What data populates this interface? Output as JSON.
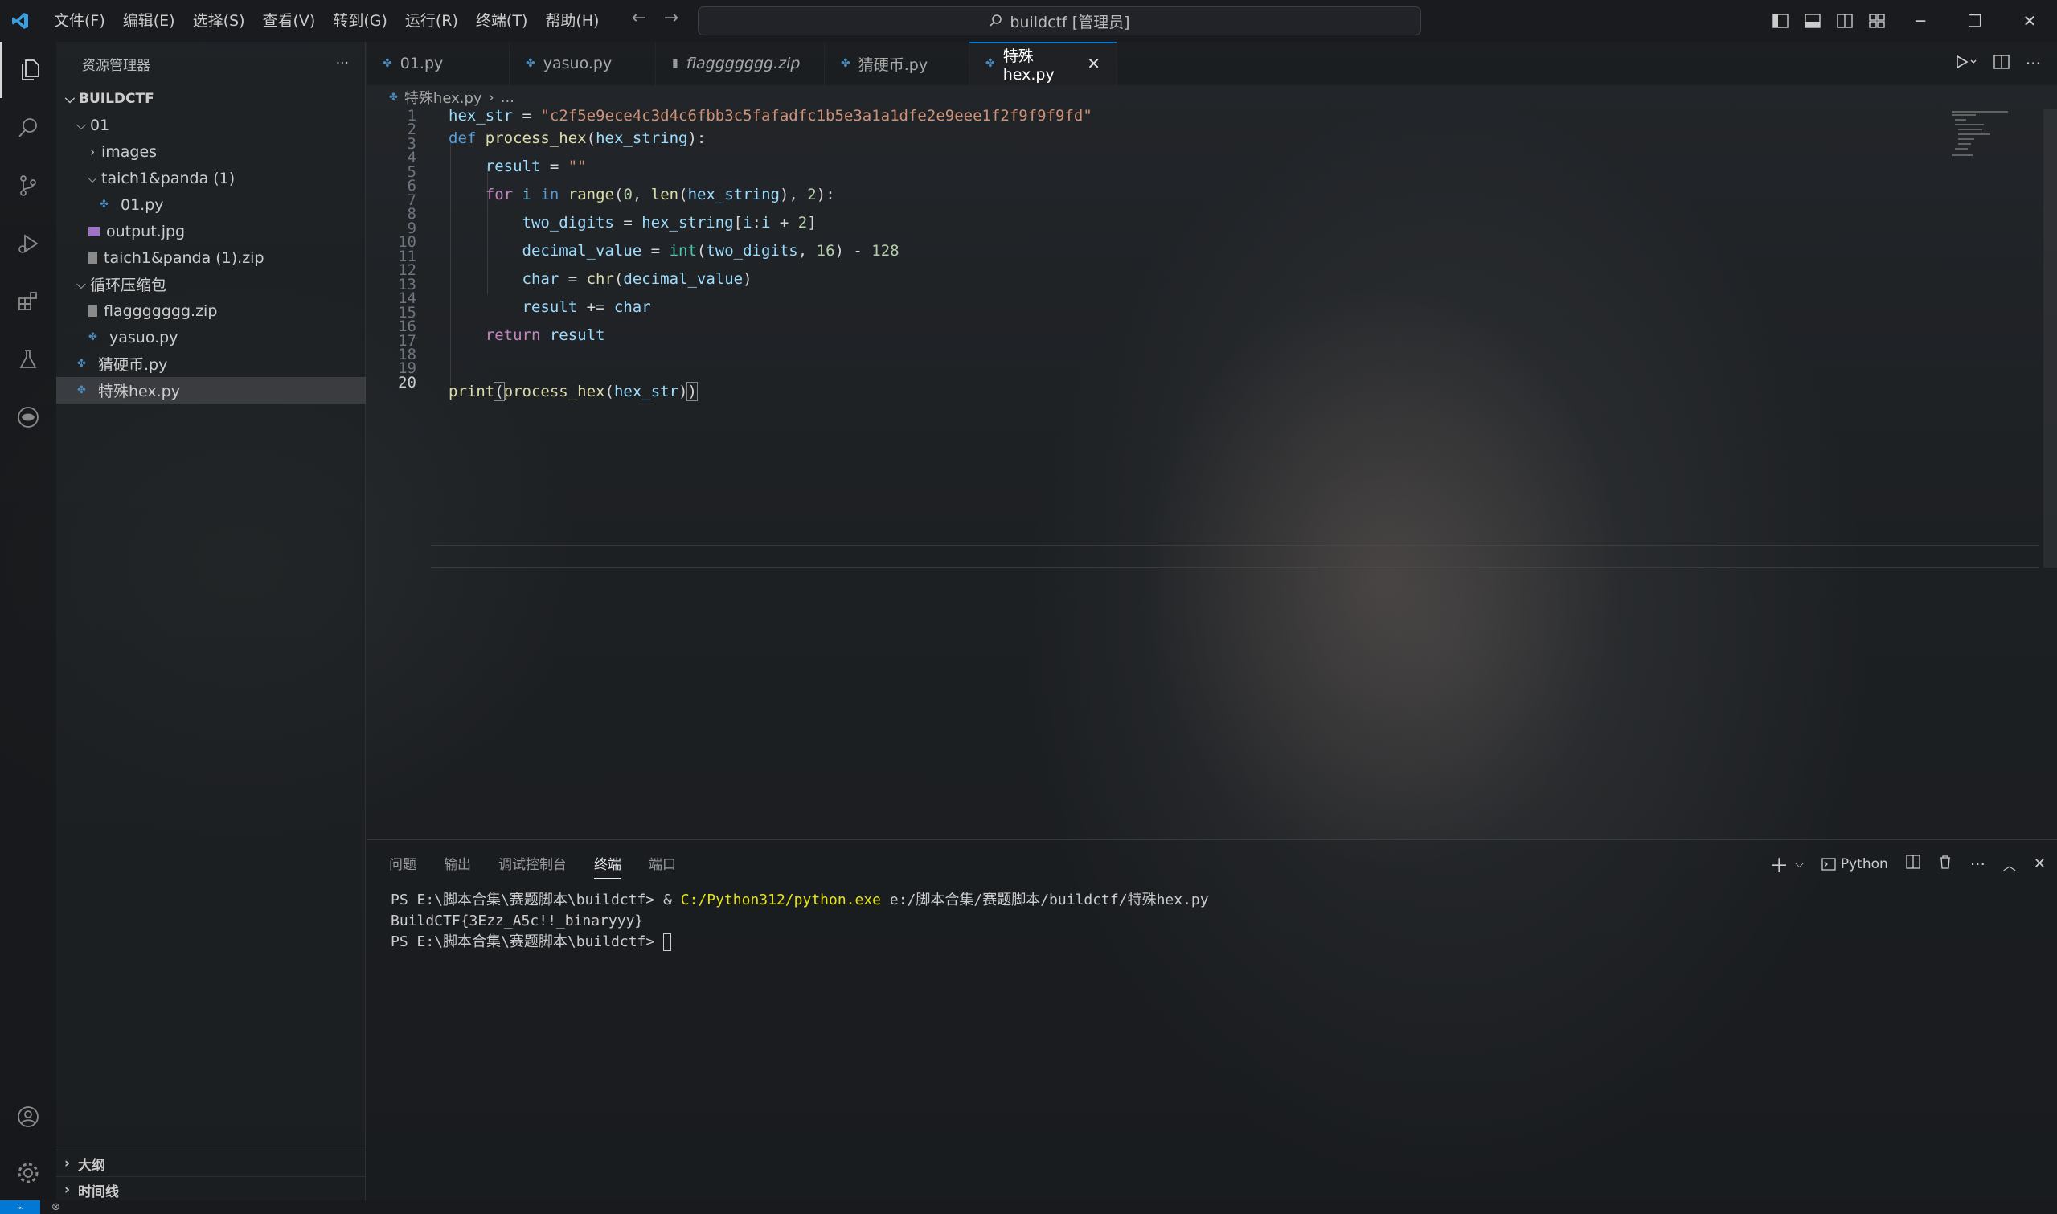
{
  "titlebar": {
    "menu": [
      "文件(F)",
      "编辑(E)",
      "选择(S)",
      "查看(V)",
      "转到(G)",
      "运行(R)",
      "终端(T)",
      "帮助(H)"
    ],
    "search_text": "buildctf [管理员]"
  },
  "sidebar": {
    "title": "资源管理器",
    "more": "···",
    "root": "BUILDCTF",
    "tree": [
      {
        "label": "01",
        "type": "folder-open",
        "depth": 1
      },
      {
        "label": "images",
        "type": "folder-closed",
        "depth": 2
      },
      {
        "label": "taich1&panda (1)",
        "type": "folder-open",
        "depth": 2
      },
      {
        "label": "01.py",
        "type": "python",
        "depth": 3
      },
      {
        "label": "output.jpg",
        "type": "image",
        "depth": 2
      },
      {
        "label": "taich1&panda (1).zip",
        "type": "zip",
        "depth": 2
      },
      {
        "label": "循环压缩包",
        "type": "folder-open",
        "depth": 1
      },
      {
        "label": "flaggggggg.zip",
        "type": "zip",
        "depth": 2
      },
      {
        "label": "yasuo.py",
        "type": "python",
        "depth": 2
      },
      {
        "label": "猜硬币.py",
        "type": "python",
        "depth": 1
      },
      {
        "label": "特殊hex.py",
        "type": "python",
        "depth": 1,
        "selected": true
      }
    ],
    "outline": "大纲",
    "timeline": "时间线"
  },
  "tabs": [
    {
      "label": "01.py",
      "italic": false,
      "active": false
    },
    {
      "label": "yasuo.py",
      "italic": false,
      "active": false
    },
    {
      "label": "flaggggggg.zip",
      "italic": true,
      "active": false
    },
    {
      "label": "猜硬币.py",
      "italic": false,
      "active": false
    },
    {
      "label": "特殊hex.py",
      "italic": false,
      "active": true
    }
  ],
  "breadcrumb": {
    "file": "特殊hex.py",
    "more": "..."
  },
  "editor": {
    "current_line": 20,
    "hex_value": "\"c2f5e9ece4c3d4c6fbb3c5fafadfc1b5e3a1a1dfe2e9eee1f2f9f9f9fd\""
  },
  "panel": {
    "tabs": [
      "问题",
      "输出",
      "调试控制台",
      "终端",
      "端口"
    ],
    "active_tab": "终端",
    "terminal_profile": "Python",
    "lines": {
      "prompt1": "PS E:\\脚本合集\\赛题脚本\\buildctf> ",
      "amp": "& ",
      "exe": "C:/Python312/python.exe",
      "arg": " e:/脚本合集/赛题脚本/buildctf/特殊hex.py",
      "output": "BuildCTF{3Ezz_A5c!!_binaryyy}",
      "prompt2": "PS E:\\脚本合集\\赛题脚本\\buildctf> "
    }
  },
  "colors": {
    "accent": "#0078d4",
    "keyword": "#569cd6",
    "control": "#c586c0",
    "variable": "#9cdcfe",
    "string": "#ce9178",
    "function": "#dcdcaa",
    "number": "#b5cea8"
  }
}
